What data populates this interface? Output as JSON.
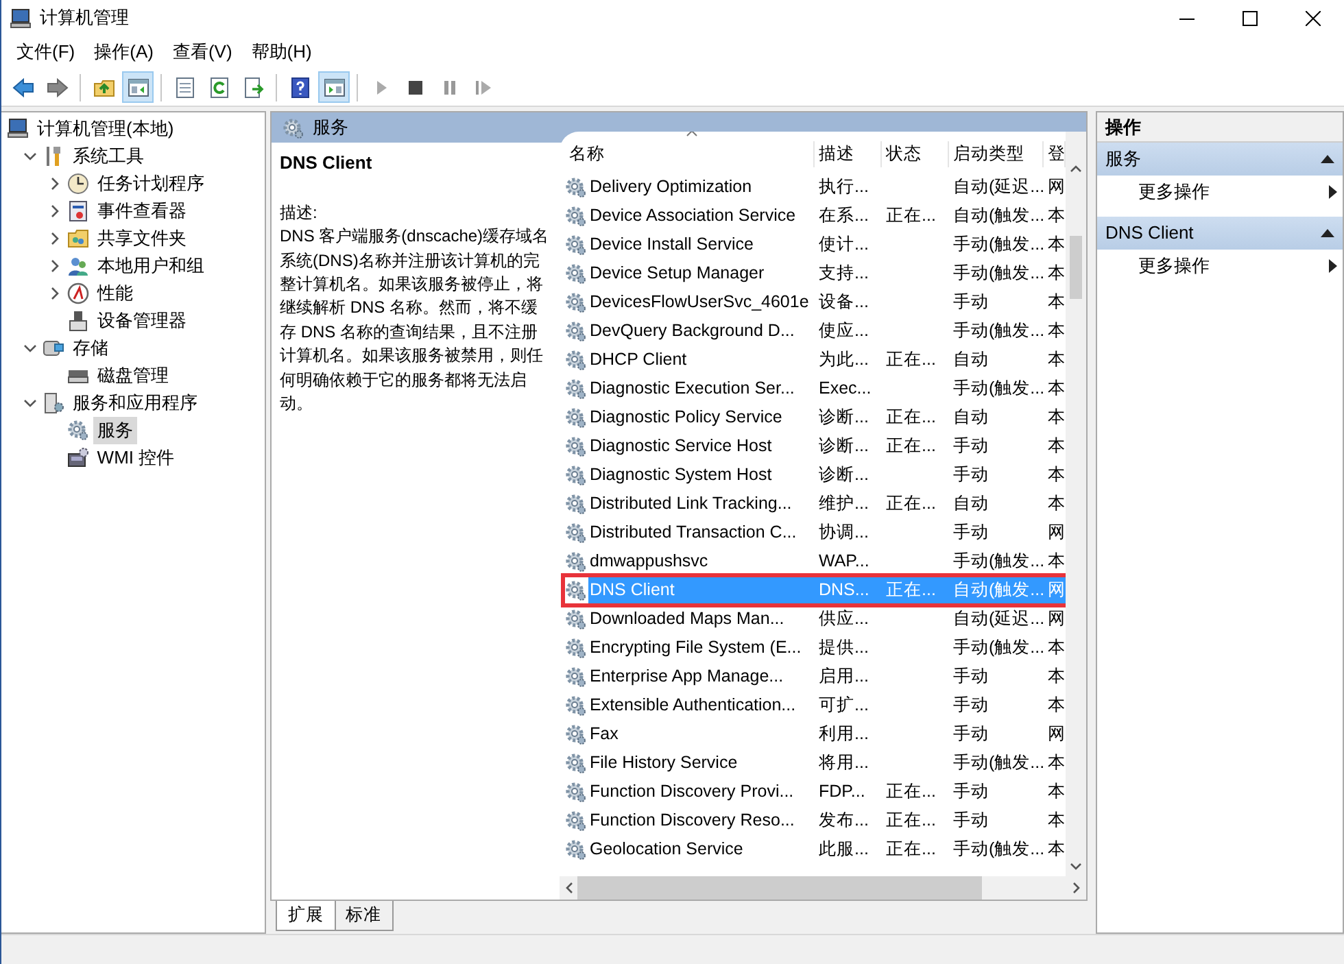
{
  "window": {
    "title": "计算机管理"
  },
  "menu": [
    "文件(F)",
    "操作(A)",
    "查看(V)",
    "帮助(H)"
  ],
  "toolbar": [
    {
      "kind": "back",
      "pressed": false
    },
    {
      "kind": "forward",
      "pressed": false
    },
    {
      "kind": "sep"
    },
    {
      "kind": "up",
      "pressed": false
    },
    {
      "kind": "tree",
      "pressed": true
    },
    {
      "kind": "sep"
    },
    {
      "kind": "props",
      "pressed": false
    },
    {
      "kind": "refresh",
      "pressed": false
    },
    {
      "kind": "export",
      "pressed": false
    },
    {
      "kind": "sep"
    },
    {
      "kind": "help",
      "pressed": false
    },
    {
      "kind": "pane",
      "pressed": true
    },
    {
      "kind": "sep"
    },
    {
      "kind": "play",
      "pressed": false
    },
    {
      "kind": "stop",
      "pressed": false
    },
    {
      "kind": "pause",
      "pressed": false
    },
    {
      "kind": "resume",
      "pressed": false
    }
  ],
  "tree": [
    {
      "label": "计算机管理(本地)",
      "kind": "computer",
      "selected": false,
      "children": [
        {
          "label": "系统工具",
          "kind": "tools",
          "expanded": true,
          "selected": false,
          "children": [
            {
              "label": "任务计划程序",
              "kind": "clock",
              "expanded": false,
              "selected": false
            },
            {
              "label": "事件查看器",
              "kind": "event",
              "expanded": false,
              "selected": false
            },
            {
              "label": "共享文件夹",
              "kind": "share",
              "expanded": false,
              "selected": false
            },
            {
              "label": "本地用户和组",
              "kind": "users",
              "expanded": false,
              "selected": false
            },
            {
              "label": "性能",
              "kind": "perf",
              "expanded": false,
              "selected": false
            },
            {
              "label": "设备管理器",
              "kind": "device",
              "selected": false
            }
          ]
        },
        {
          "label": "存储",
          "kind": "storage",
          "expanded": true,
          "selected": false,
          "children": [
            {
              "label": "磁盘管理",
              "kind": "disk",
              "selected": false
            }
          ]
        },
        {
          "label": "服务和应用程序",
          "kind": "apps",
          "expanded": true,
          "selected": false,
          "children": [
            {
              "label": "服务",
              "kind": "service",
              "selected": true
            },
            {
              "label": "WMI 控件",
              "kind": "wmi",
              "selected": false
            }
          ]
        }
      ]
    }
  ],
  "services": {
    "header": "服务",
    "detail": {
      "title": "DNS Client",
      "label": "描述:",
      "text": "DNS 客户端服务(dnscache)缓存域名系统(DNS)名称并注册该计算机的完整计算机名。如果该服务被停止，将继续解析 DNS 名称。然而，将不缓存 DNS 名称的查询结果，且不注册计算机名。如果该服务被禁用，则任何明确依赖于它的服务都将无法启动。"
    },
    "columns": [
      "名称",
      "描述",
      "状态",
      "启动类型",
      "登"
    ],
    "rows": [
      {
        "name": "Delivery Optimization",
        "description": "执行...",
        "startup": "自动(延迟...",
        "logon": "网",
        "selected": false
      },
      {
        "name": "Device Association Service",
        "description": "在系...",
        "status": "正在...",
        "startup": "自动(触发...",
        "logon": "本",
        "selected": false
      },
      {
        "name": "Device Install Service",
        "description": "使计...",
        "startup": "手动(触发...",
        "logon": "本",
        "selected": false
      },
      {
        "name": "Device Setup Manager",
        "description": "支持...",
        "startup": "手动(触发...",
        "logon": "本",
        "selected": false
      },
      {
        "name": "DevicesFlowUserSvc_4601e",
        "description": "设备...",
        "startup": "手动",
        "logon": "本",
        "selected": false
      },
      {
        "name": "DevQuery Background D...",
        "description": "使应...",
        "startup": "手动(触发...",
        "logon": "本",
        "selected": false
      },
      {
        "name": "DHCP Client",
        "description": "为此...",
        "status": "正在...",
        "startup": "自动",
        "logon": "本",
        "selected": false
      },
      {
        "name": "Diagnostic Execution Ser...",
        "description": "Exec...",
        "startup": "手动(触发...",
        "logon": "本",
        "selected": false
      },
      {
        "name": "Diagnostic Policy Service",
        "description": "诊断...",
        "status": "正在...",
        "startup": "自动",
        "logon": "本",
        "selected": false
      },
      {
        "name": "Diagnostic Service Host",
        "description": "诊断...",
        "status": "正在...",
        "startup": "手动",
        "logon": "本",
        "selected": false
      },
      {
        "name": "Diagnostic System Host",
        "description": "诊断...",
        "startup": "手动",
        "logon": "本",
        "selected": false
      },
      {
        "name": "Distributed Link Tracking...",
        "description": "维护...",
        "status": "正在...",
        "startup": "自动",
        "logon": "本",
        "selected": false
      },
      {
        "name": "Distributed Transaction C...",
        "description": "协调...",
        "startup": "手动",
        "logon": "网",
        "selected": false
      },
      {
        "name": "dmwappushsvc",
        "description": "WAP...",
        "startup": "手动(触发...",
        "logon": "本",
        "selected": false
      },
      {
        "name": "DNS Client",
        "description": "DNS...",
        "status": "正在...",
        "startup": "自动(触发...",
        "logon": "网",
        "selected": true,
        "annotated": true
      },
      {
        "name": "Downloaded Maps Man...",
        "description": "供应...",
        "startup": "自动(延迟...",
        "logon": "网",
        "selected": false
      },
      {
        "name": "Encrypting File System (E...",
        "description": "提供...",
        "startup": "手动(触发...",
        "logon": "本",
        "selected": false
      },
      {
        "name": "Enterprise App Manage...",
        "description": "启用...",
        "startup": "手动",
        "logon": "本",
        "selected": false
      },
      {
        "name": "Extensible Authentication...",
        "description": "可扩...",
        "startup": "手动",
        "logon": "本",
        "selected": false
      },
      {
        "name": "Fax",
        "description": "利用...",
        "startup": "手动",
        "logon": "网",
        "selected": false
      },
      {
        "name": "File History Service",
        "description": "将用...",
        "startup": "手动(触发...",
        "logon": "本",
        "selected": false
      },
      {
        "name": "Function Discovery Provi...",
        "description": "FDP...",
        "status": "正在...",
        "startup": "手动",
        "logon": "本",
        "selected": false
      },
      {
        "name": "Function Discovery Reso...",
        "description": "发布...",
        "status": "正在...",
        "startup": "手动",
        "logon": "本",
        "selected": false
      },
      {
        "name": "Geolocation Service",
        "description": "此服...",
        "status": "正在...",
        "startup": "手动(触发...",
        "logon": "本",
        "selected": false
      }
    ],
    "view_tabs": [
      {
        "label": "扩展",
        "selected": true
      },
      {
        "label": "标准",
        "selected": false
      }
    ]
  },
  "actions": {
    "title": "操作",
    "sections": [
      {
        "title": "服务",
        "items": [
          "更多操作"
        ]
      },
      {
        "title": "DNS Client",
        "items": [
          "更多操作"
        ]
      }
    ]
  }
}
